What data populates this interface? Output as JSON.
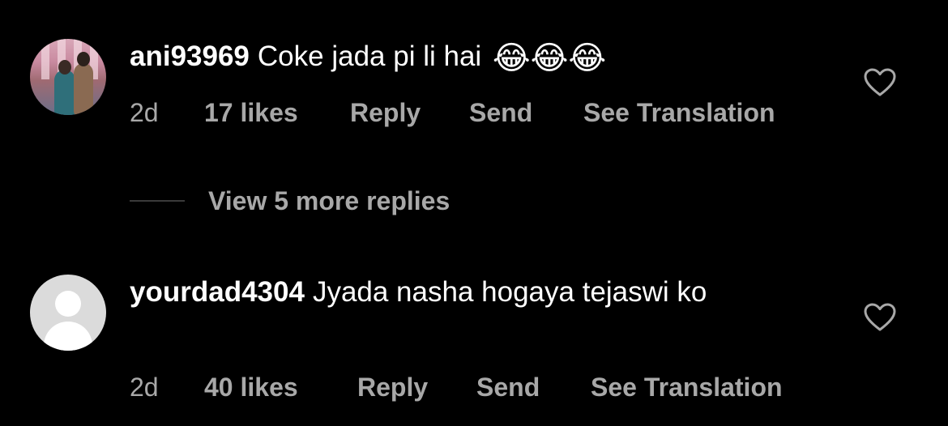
{
  "comments": [
    {
      "username": "ani93969",
      "text": "Coke jada pi li hai",
      "emoji": "😂😂😂",
      "age": "2d",
      "likes": "17 likes",
      "reply_label": "Reply",
      "send_label": "Send",
      "translation_label": "See Translation",
      "avatar": "profile-photo",
      "like_icon": "heart-outline-icon"
    },
    {
      "username": "yourdad4304",
      "text": "Jyada nasha hogaya tejaswi ko",
      "age": "2d",
      "likes": "40 likes",
      "reply_label": "Reply",
      "send_label": "Send",
      "translation_label": "See Translation",
      "avatar": "default-avatar",
      "like_icon": "heart-outline-icon"
    }
  ],
  "view_more_replies": "View 5 more replies",
  "colors": {
    "background": "#000000",
    "primary_text": "#ffffff",
    "secondary_text": "#a8a8a8",
    "default_avatar": "#dbdbdb"
  }
}
